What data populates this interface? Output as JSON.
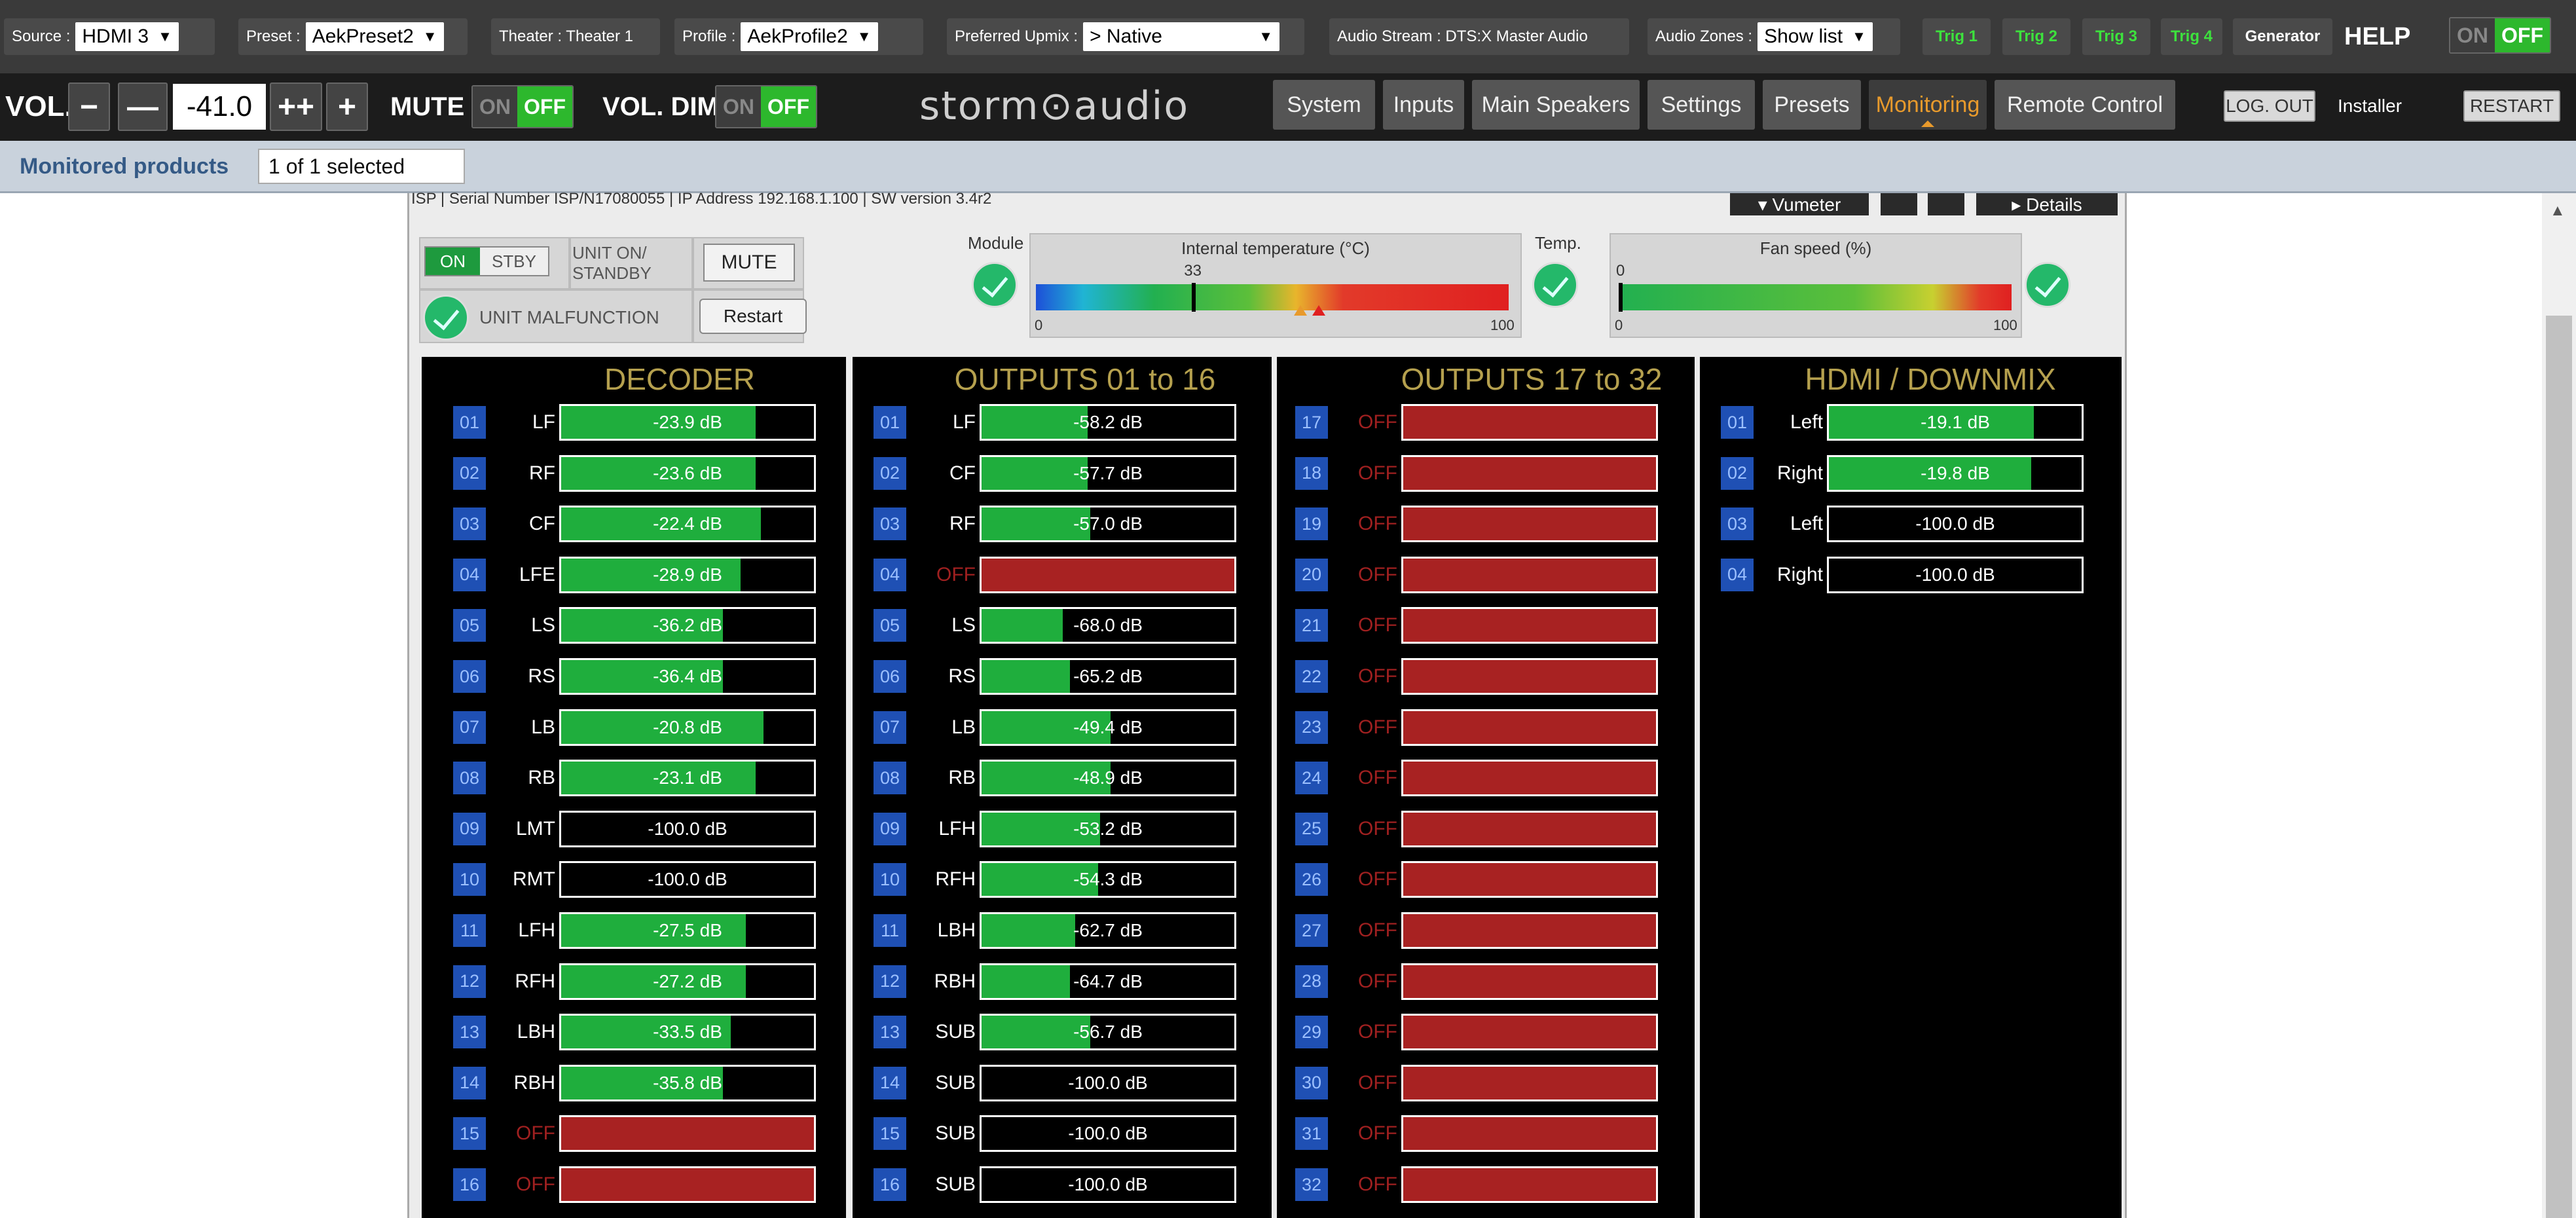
{
  "topbar": {
    "source_label": "Source :",
    "source_value": "HDMI 3",
    "preset_label": "Preset :",
    "preset_value": "AekPreset2",
    "theater_label": "Theater : Theater 1",
    "profile_label": "Profile :",
    "profile_value": "AekProfile2",
    "upmix_label": "Preferred Upmix :",
    "upmix_value": "> Native",
    "audio_stream": "Audio Stream : DTS:X Master Audio",
    "zones_label": "Audio Zones :",
    "zones_value": "Show list",
    "trig1": "Trig 1",
    "trig2": "Trig 2",
    "trig3": "Trig 3",
    "trig4": "Trig 4",
    "generator": "Generator",
    "help": "HELP",
    "on": "ON",
    "off": "OFF",
    "dropdown": "▼"
  },
  "volbar": {
    "vol_label": "VOL.",
    "minus": "−",
    "minusminus": "—",
    "value": "-41.0",
    "plusplus": "++",
    "plus": "+",
    "mute_label": "MUTE",
    "dim_label": "VOL. DIM",
    "on": "ON",
    "off": "OFF",
    "logo": "storm⊙audio"
  },
  "nav": {
    "items": [
      "System",
      "Inputs",
      "Main Speakers",
      "Settings",
      "Presets",
      "Monitoring",
      "Remote Control"
    ],
    "logout": "LOG. OUT",
    "installer": "Installer",
    "restart": "RESTART"
  },
  "monitored": {
    "label": "Monitored products",
    "selected": "1 of 1 selected"
  },
  "device": {
    "line": "ISP  |  Serial Number ISP/N17080055  |  IP Address 192.168.1.100  |  SW version 3.4r2",
    "vumeter": "▾ Vumeter",
    "details": "▸ Details",
    "on": "ON",
    "stby": "STBY",
    "unit_on": "UNIT ON/\nSTANDBY",
    "mute": "MUTE",
    "malfunction": "UNIT MALFUNCTION",
    "restart": "Restart",
    "module": "Module",
    "temp_title": "Internal temperature (°C)",
    "temp_value": "33",
    "temp_min": "0",
    "temp_max": "100",
    "temp_label": "Temp.",
    "fan_title": "Fan speed (%)",
    "fan_zero": "0",
    "fan_min": "0",
    "fan_max": "100",
    "temp_level": 0.33,
    "fan_level": 0.0
  },
  "decoder": {
    "title": "DECODER",
    "rows": [
      {
        "n": "01",
        "label": "LF",
        "value": "-23.9 dB",
        "level": 0.77
      },
      {
        "n": "02",
        "label": "RF",
        "value": "-23.6 dB",
        "level": 0.77
      },
      {
        "n": "03",
        "label": "CF",
        "value": "-22.4 dB",
        "level": 0.79
      },
      {
        "n": "04",
        "label": "LFE",
        "value": "-28.9 dB",
        "level": 0.71
      },
      {
        "n": "05",
        "label": "LS",
        "value": "-36.2 dB",
        "level": 0.64
      },
      {
        "n": "06",
        "label": "RS",
        "value": "-36.4 dB",
        "level": 0.64
      },
      {
        "n": "07",
        "label": "LB",
        "value": "-20.8 dB",
        "level": 0.8
      },
      {
        "n": "08",
        "label": "RB",
        "value": "-23.1 dB",
        "level": 0.77
      },
      {
        "n": "09",
        "label": "LMT",
        "value": "-100.0 dB",
        "level": 0
      },
      {
        "n": "10",
        "label": "RMT",
        "value": "-100.0 dB",
        "level": 0
      },
      {
        "n": "11",
        "label": "LFH",
        "value": "-27.5 dB",
        "level": 0.73
      },
      {
        "n": "12",
        "label": "RFH",
        "value": "-27.2 dB",
        "level": 0.73
      },
      {
        "n": "13",
        "label": "LBH",
        "value": "-33.5 dB",
        "level": 0.67
      },
      {
        "n": "14",
        "label": "RBH",
        "value": "-35.8 dB",
        "level": 0.64
      },
      {
        "n": "15",
        "label": "OFF",
        "value": "",
        "level": 0,
        "off": true
      },
      {
        "n": "16",
        "label": "OFF",
        "value": "",
        "level": 0,
        "off": true
      }
    ]
  },
  "outputs1": {
    "title": "OUTPUTS 01 to 16",
    "rows": [
      {
        "n": "01",
        "label": "LF",
        "value": "-58.2 dB",
        "level": 0.42
      },
      {
        "n": "02",
        "label": "CF",
        "value": "-57.7 dB",
        "level": 0.42
      },
      {
        "n": "03",
        "label": "RF",
        "value": "-57.0 dB",
        "level": 0.43
      },
      {
        "n": "04",
        "label": "OFF",
        "value": "",
        "level": 0,
        "off": true
      },
      {
        "n": "05",
        "label": "LS",
        "value": "-68.0 dB",
        "level": 0.32
      },
      {
        "n": "06",
        "label": "RS",
        "value": "-65.2 dB",
        "level": 0.35
      },
      {
        "n": "07",
        "label": "LB",
        "value": "-49.4 dB",
        "level": 0.51
      },
      {
        "n": "08",
        "label": "RB",
        "value": "-48.9 dB",
        "level": 0.51
      },
      {
        "n": "09",
        "label": "LFH",
        "value": "-53.2 dB",
        "level": 0.47
      },
      {
        "n": "10",
        "label": "RFH",
        "value": "-54.3 dB",
        "level": 0.46
      },
      {
        "n": "11",
        "label": "LBH",
        "value": "-62.7 dB",
        "level": 0.37
      },
      {
        "n": "12",
        "label": "RBH",
        "value": "-64.7 dB",
        "level": 0.35
      },
      {
        "n": "13",
        "label": "SUB",
        "value": "-56.7 dB",
        "level": 0.43
      },
      {
        "n": "14",
        "label": "SUB",
        "value": "-100.0 dB",
        "level": 0
      },
      {
        "n": "15",
        "label": "SUB",
        "value": "-100.0 dB",
        "level": 0
      },
      {
        "n": "16",
        "label": "SUB",
        "value": "-100.0 dB",
        "level": 0
      }
    ]
  },
  "outputs2": {
    "title": "OUTPUTS 17 to 32",
    "rows": [
      {
        "n": "17",
        "label": "OFF",
        "value": "",
        "level": 0,
        "off": true
      },
      {
        "n": "18",
        "label": "OFF",
        "value": "",
        "level": 0,
        "off": true
      },
      {
        "n": "19",
        "label": "OFF",
        "value": "",
        "level": 0,
        "off": true
      },
      {
        "n": "20",
        "label": "OFF",
        "value": "",
        "level": 0,
        "off": true
      },
      {
        "n": "21",
        "label": "OFF",
        "value": "",
        "level": 0,
        "off": true
      },
      {
        "n": "22",
        "label": "OFF",
        "value": "",
        "level": 0,
        "off": true
      },
      {
        "n": "23",
        "label": "OFF",
        "value": "",
        "level": 0,
        "off": true
      },
      {
        "n": "24",
        "label": "OFF",
        "value": "",
        "level": 0,
        "off": true
      },
      {
        "n": "25",
        "label": "OFF",
        "value": "",
        "level": 0,
        "off": true
      },
      {
        "n": "26",
        "label": "OFF",
        "value": "",
        "level": 0,
        "off": true
      },
      {
        "n": "27",
        "label": "OFF",
        "value": "",
        "level": 0,
        "off": true
      },
      {
        "n": "28",
        "label": "OFF",
        "value": "",
        "level": 0,
        "off": true
      },
      {
        "n": "29",
        "label": "OFF",
        "value": "",
        "level": 0,
        "off": true
      },
      {
        "n": "30",
        "label": "OFF",
        "value": "",
        "level": 0,
        "off": true
      },
      {
        "n": "31",
        "label": "OFF",
        "value": "",
        "level": 0,
        "off": true
      },
      {
        "n": "32",
        "label": "OFF",
        "value": "",
        "level": 0,
        "off": true
      }
    ]
  },
  "hdmi": {
    "title": "HDMI / DOWNMIX",
    "rows": [
      {
        "n": "01",
        "label": "Left",
        "value": "-19.1 dB",
        "level": 0.81
      },
      {
        "n": "02",
        "label": "Right",
        "value": "-19.8 dB",
        "level": 0.8
      },
      {
        "n": "03",
        "label": "Left",
        "value": "-100.0 dB",
        "level": 0
      },
      {
        "n": "04",
        "label": "Right",
        "value": "-100.0 dB",
        "level": 0
      }
    ]
  },
  "colors": {
    "green": "#1fae3d",
    "red": "#a82222",
    "blue": "#1f50b4",
    "accent": "#e89a2c",
    "title": "#b5a04e"
  }
}
